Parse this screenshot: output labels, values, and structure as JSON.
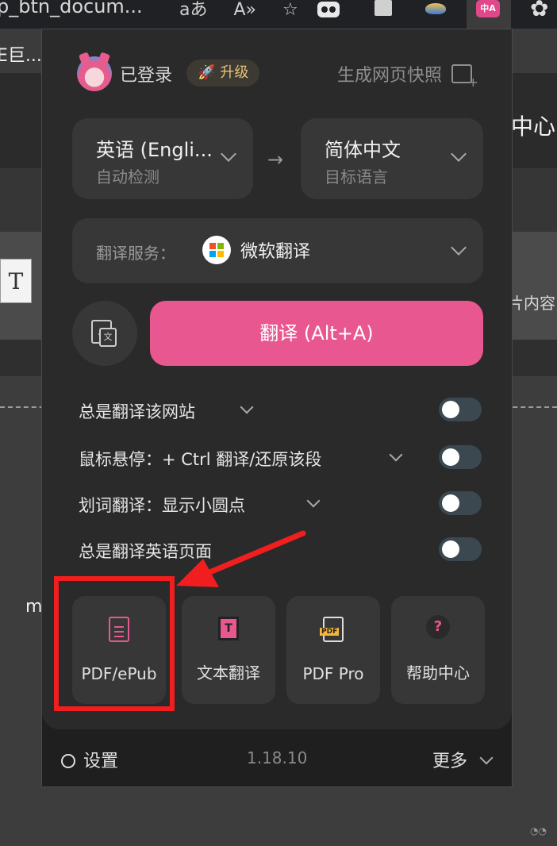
{
  "browser": {
    "tab_title": "p_btn_docum...",
    "toolbar_icons": [
      "aあ",
      "A»",
      "☆"
    ]
  },
  "background_page": {
    "bar_text": "E巨...",
    "right_heading": "中心",
    "right_subtext": "片内容",
    "t_label": "T",
    "left_letter": "m"
  },
  "popup": {
    "header": {
      "login_status": "已登录",
      "upgrade_label": "升级",
      "snapshot_label": "生成网页快照"
    },
    "source_language": {
      "name": "英语 (Engli...",
      "sub": "自动检测"
    },
    "target_language": {
      "name": "简体中文",
      "sub": "目标语言"
    },
    "service": {
      "label": "翻译服务：",
      "name": "微软翻译"
    },
    "translate_button": "翻译 (Alt+A)",
    "options": [
      {
        "label": "总是翻译该网站",
        "has_dropdown": true,
        "enabled": false
      },
      {
        "label": "鼠标悬停：+ Ctrl 翻译/还原该段",
        "has_dropdown": true,
        "enabled": false
      },
      {
        "label": "划词翻译：显示小圆点",
        "has_dropdown": true,
        "enabled": false
      },
      {
        "label": "总是翻译英语页面",
        "has_dropdown": false,
        "enabled": false
      }
    ],
    "tools": [
      {
        "label": "PDF/ePub",
        "icon": "pdf-document-icon"
      },
      {
        "label": "文本翻译",
        "icon": "text-translate-icon"
      },
      {
        "label": "PDF Pro",
        "icon": "pdf-pro-icon"
      },
      {
        "label": "帮助中心",
        "icon": "help-icon"
      }
    ],
    "footer": {
      "settings_label": "设置",
      "version": "1.18.10",
      "more_label": "更多"
    }
  },
  "colors": {
    "accent_pink": "#e8578f",
    "annotation_red": "#f01e1e",
    "popup_bg": "#2a2a2b"
  }
}
